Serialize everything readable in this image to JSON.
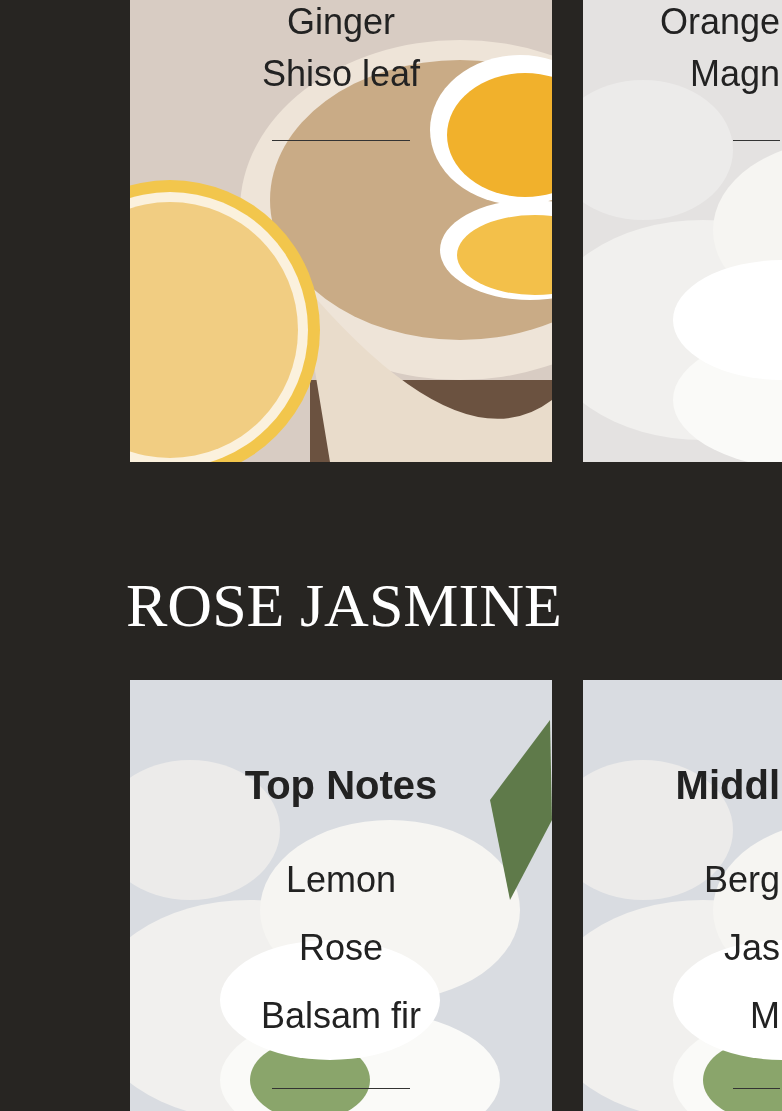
{
  "sections": [
    {
      "cards": [
        {
          "notes": [
            "Ginger",
            "Shiso leaf"
          ]
        },
        {
          "notes": [
            "Orange",
            "Magn"
          ]
        }
      ]
    },
    {
      "title": "ROSE JASMINE",
      "cards": [
        {
          "heading": "Top Notes",
          "notes": [
            "Lemon",
            "Rose",
            "Balsam fir"
          ]
        },
        {
          "heading": "Middl",
          "notes": [
            "Berg",
            "Jas",
            "M"
          ]
        }
      ]
    }
  ]
}
